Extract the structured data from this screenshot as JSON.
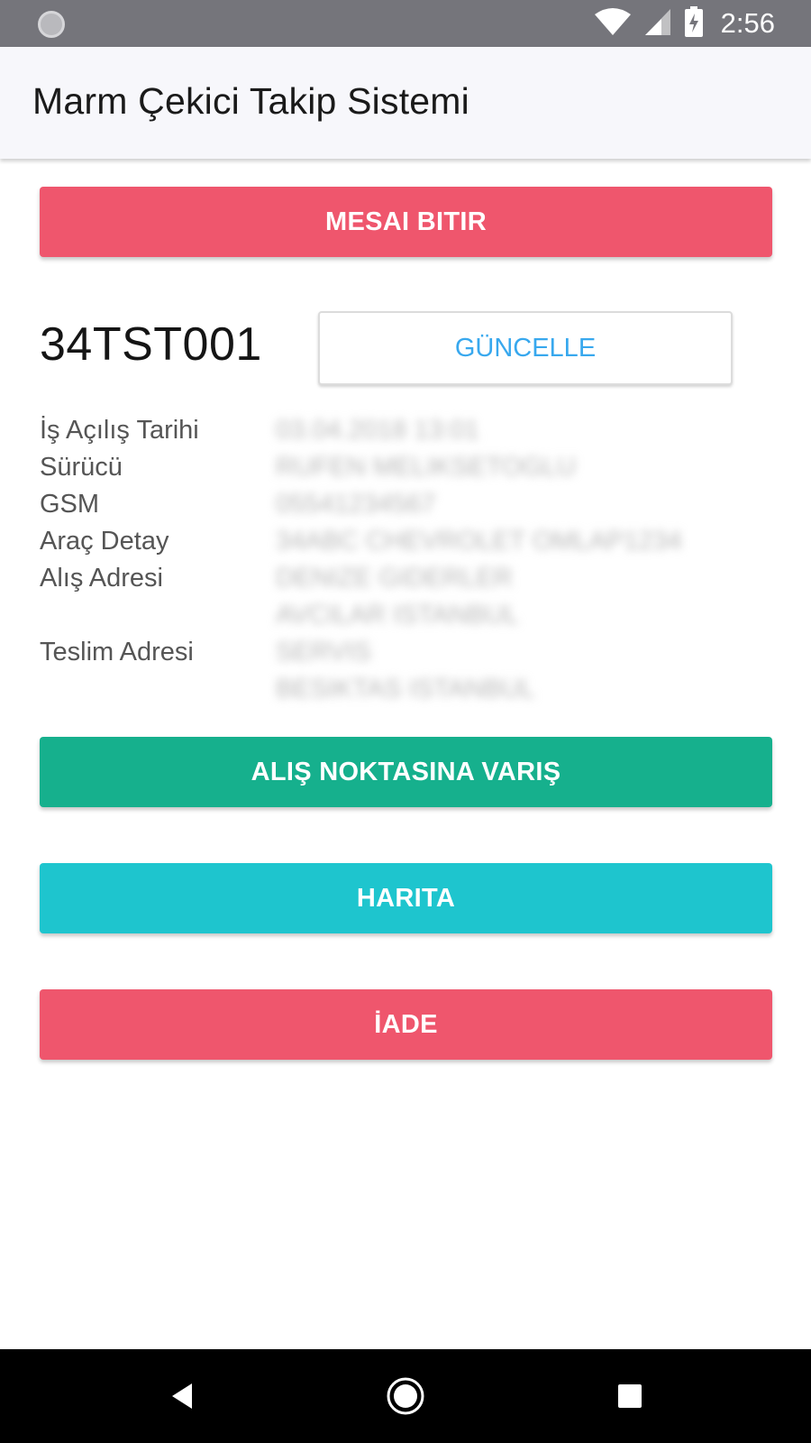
{
  "status_bar": {
    "time": "2:56",
    "icons": [
      "notification-dot-icon",
      "wifi-icon",
      "signal-icon",
      "battery-charging-icon"
    ],
    "background": "#75757b"
  },
  "app_bar": {
    "title": "Marm Çekici Takip Sistemi"
  },
  "buttons": {
    "end_shift": "MESAI BITIR",
    "update": "GÜNCELLE",
    "arrive_pickup": "ALIŞ NOKTASINA VARIŞ",
    "map": "HARITA",
    "return": "İADE"
  },
  "vehicle": {
    "plate": "34TST001"
  },
  "details": [
    {
      "label": "İş Açılış Tarihi",
      "value": "03.04.2018 13:01"
    },
    {
      "label": "Sürücü",
      "value": "RUFEN MELIKSETOGLU"
    },
    {
      "label": "GSM",
      "value": "05541234567"
    },
    {
      "label": "Araç Detay",
      "value": "34ABC CHEVROLET OMLAP1234"
    },
    {
      "label": "Alış Adresi",
      "value": "DENIZE GIDERLER"
    },
    {
      "label": "",
      "value": "AVCILAR ISTANBUL"
    },
    {
      "label": "Teslim Adresi",
      "value": "SERVIS"
    },
    {
      "label": "",
      "value": "BESIKTAS ISTANBUL"
    }
  ],
  "colors": {
    "red": "#ef566d",
    "green": "#16b08d",
    "cyan": "#1ec5ce",
    "link_blue": "#38a8ee"
  },
  "nav_bar": {
    "icons": [
      "back-icon",
      "home-icon",
      "recents-icon"
    ]
  }
}
